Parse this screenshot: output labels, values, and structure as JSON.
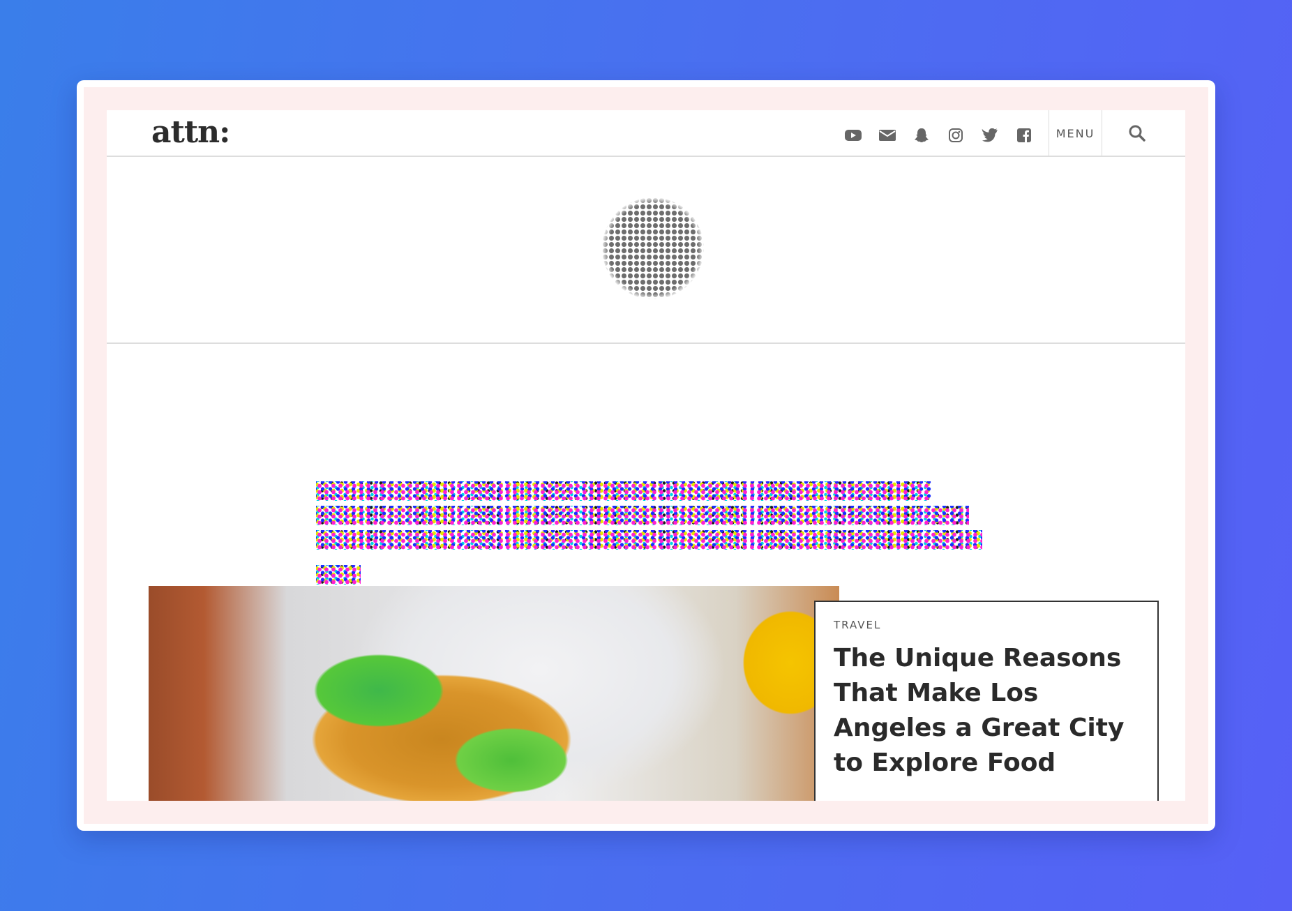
{
  "site": {
    "logo": "attn:",
    "menu_label": "MENU"
  },
  "header": {
    "social_icons": [
      "youtube-icon",
      "email-icon",
      "snapchat-icon",
      "instagram-icon",
      "twitter-icon",
      "facebook-icon"
    ],
    "search_icon": "search-icon"
  },
  "feature": {
    "category": "TRAVEL",
    "title": "The Unique Reasons That Make Los Angeles a Great City to Explore Food"
  },
  "colors": {
    "background_gradient": [
      "#3a7eea",
      "#5660f6"
    ],
    "frame_inner": "#fdeeee",
    "logo": "#2c2c2c",
    "icons": "#666666"
  }
}
